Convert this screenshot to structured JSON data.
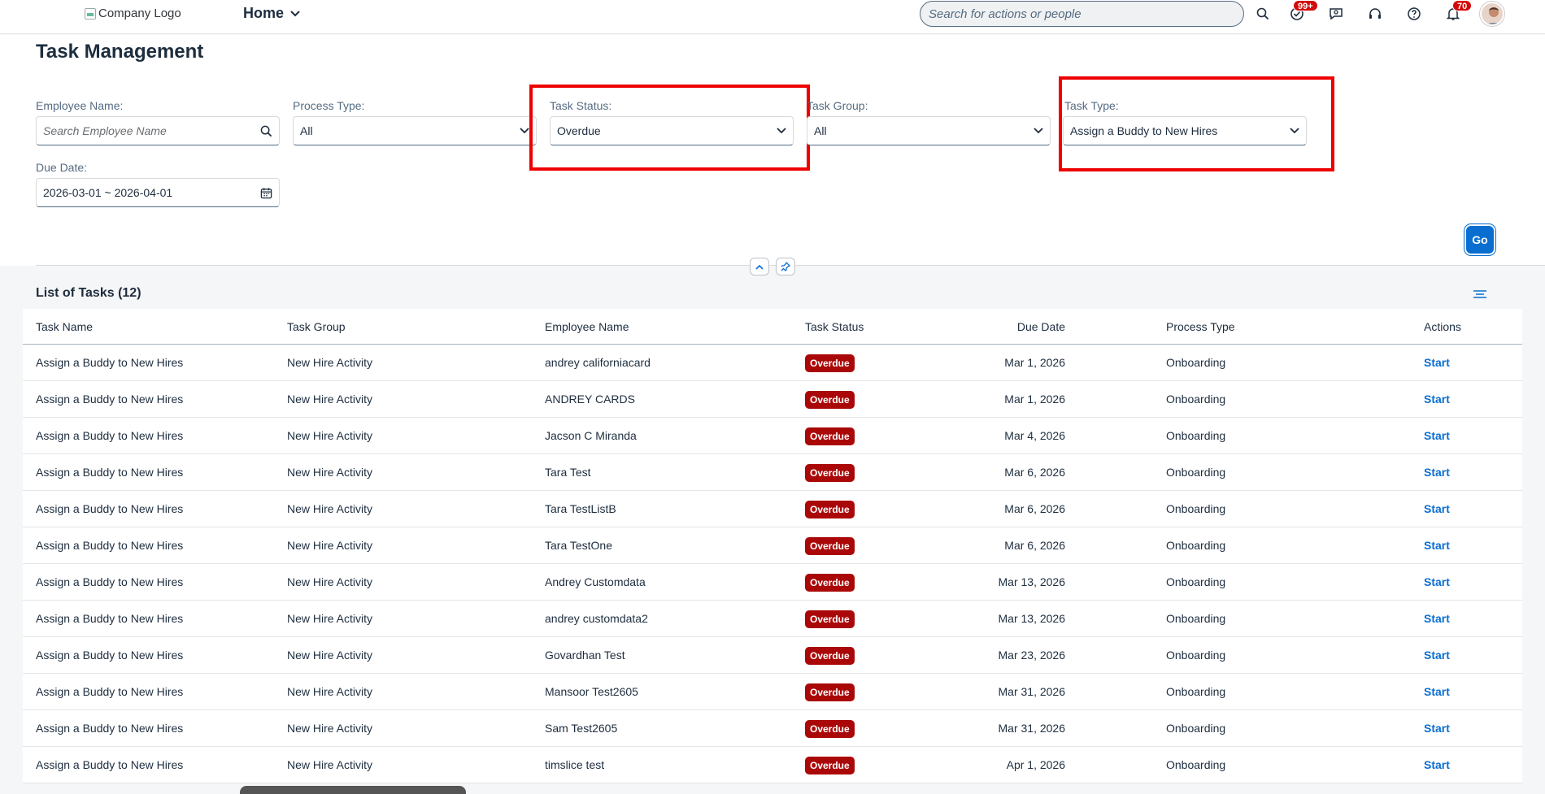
{
  "shell": {
    "logo_alt": "Company Logo",
    "home_label": "Home",
    "search_placeholder": "Search for actions or people",
    "todo_badge": "99+",
    "notif_badge": "70"
  },
  "page": {
    "title": "Task Management"
  },
  "filters": {
    "employee_name": {
      "label": "Employee Name:",
      "placeholder": "Search Employee Name"
    },
    "process_type": {
      "label": "Process Type:",
      "value": "All"
    },
    "task_status": {
      "label": "Task Status:",
      "value": "Overdue"
    },
    "task_group": {
      "label": "Task Group:",
      "value": "All"
    },
    "task_type": {
      "label": "Task Type:",
      "value": "Assign a Buddy to New Hires"
    },
    "due_date": {
      "label": "Due Date:",
      "value": "2026-03-01 ~ 2026-04-01"
    },
    "go_label": "Go"
  },
  "table": {
    "title": "List of Tasks (12)",
    "columns": [
      "Task Name",
      "Task Group",
      "Employee Name",
      "Task Status",
      "Due Date",
      "Process Type",
      "Actions"
    ],
    "rows": [
      {
        "task": "Assign a Buddy to New Hires",
        "group": "New Hire Activity",
        "employee": "andrey californiacard",
        "status": "Overdue",
        "due": "Mar 1, 2026",
        "process": "Onboarding",
        "action": "Start"
      },
      {
        "task": "Assign a Buddy to New Hires",
        "group": "New Hire Activity",
        "employee": "ANDREY CARDS",
        "status": "Overdue",
        "due": "Mar 1, 2026",
        "process": "Onboarding",
        "action": "Start"
      },
      {
        "task": "Assign a Buddy to New Hires",
        "group": "New Hire Activity",
        "employee": "Jacson C Miranda",
        "status": "Overdue",
        "due": "Mar 4, 2026",
        "process": "Onboarding",
        "action": "Start"
      },
      {
        "task": "Assign a Buddy to New Hires",
        "group": "New Hire Activity",
        "employee": "Tara Test",
        "status": "Overdue",
        "due": "Mar 6, 2026",
        "process": "Onboarding",
        "action": "Start"
      },
      {
        "task": "Assign a Buddy to New Hires",
        "group": "New Hire Activity",
        "employee": "Tara TestListB",
        "status": "Overdue",
        "due": "Mar 6, 2026",
        "process": "Onboarding",
        "action": "Start"
      },
      {
        "task": "Assign a Buddy to New Hires",
        "group": "New Hire Activity",
        "employee": "Tara TestOne",
        "status": "Overdue",
        "due": "Mar 6, 2026",
        "process": "Onboarding",
        "action": "Start"
      },
      {
        "task": "Assign a Buddy to New Hires",
        "group": "New Hire Activity",
        "employee": "Andrey Customdata",
        "status": "Overdue",
        "due": "Mar 13, 2026",
        "process": "Onboarding",
        "action": "Start"
      },
      {
        "task": "Assign a Buddy to New Hires",
        "group": "New Hire Activity",
        "employee": "andrey customdata2",
        "status": "Overdue",
        "due": "Mar 13, 2026",
        "process": "Onboarding",
        "action": "Start"
      },
      {
        "task": "Assign a Buddy to New Hires",
        "group": "New Hire Activity",
        "employee": "Govardhan Test",
        "status": "Overdue",
        "due": "Mar 23, 2026",
        "process": "Onboarding",
        "action": "Start"
      },
      {
        "task": "Assign a Buddy to New Hires",
        "group": "New Hire Activity",
        "employee": "Mansoor Test2605",
        "status": "Overdue",
        "due": "Mar 31, 2026",
        "process": "Onboarding",
        "action": "Start"
      },
      {
        "task": "Assign a Buddy to New Hires",
        "group": "New Hire Activity",
        "employee": "Sam Test2605",
        "status": "Overdue",
        "due": "Mar 31, 2026",
        "process": "Onboarding",
        "action": "Start"
      },
      {
        "task": "Assign a Buddy to New Hires",
        "group": "New Hire Activity",
        "employee": "timslice test",
        "status": "Overdue",
        "due": "Apr 1, 2026",
        "process": "Onboarding",
        "action": "Start"
      }
    ]
  }
}
